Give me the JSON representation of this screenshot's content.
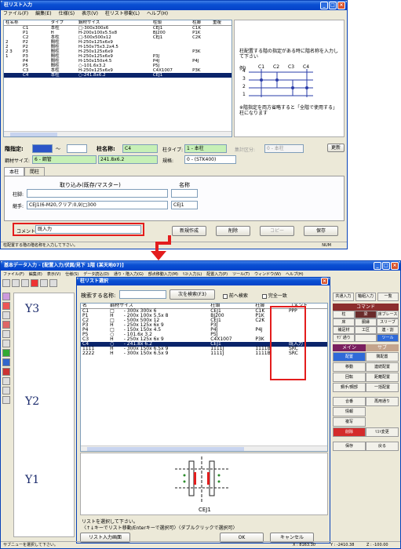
{
  "top": {
    "title": "柱リスト入力",
    "menu": [
      "ファイル(F)",
      "編集(E)",
      "仕様(S)",
      "表示(V)",
      "柱リスト移動(L)",
      "ヘルプ(H)"
    ],
    "cols": [
      "柱名称",
      "タイプ",
      "鋼材サイズ",
      "柱頭",
      "柱脚",
      "重複"
    ],
    "rows": [
      [
        "",
        "C1",
        "本柱",
        "□-300x300x6",
        "CEJ1",
        "C1K",
        ""
      ],
      [
        "",
        "P1",
        "H",
        "H-200x100x5.5x8",
        "BJ200",
        "P1K",
        ""
      ],
      [
        "",
        "C2",
        "本柱",
        "□-500x500x12",
        "CEJ1",
        "C2K",
        ""
      ],
      [
        "2",
        "P2",
        "間柱",
        "H-250x125x6x9",
        "",
        "",
        ""
      ],
      [
        "2",
        "P2",
        "間柱",
        "H-150x75x3.2x4.5",
        "",
        "",
        ""
      ],
      [
        "2  3",
        "P3",
        "間柱",
        "H-250x125x6x9",
        "",
        "P3K",
        ""
      ],
      [
        "1",
        "P3",
        "間柱",
        "H-250x125x6x9",
        "P3J",
        "",
        ""
      ],
      [
        "",
        "P4",
        "間柱",
        "H-150x150x4.5",
        "P4J",
        "P4J",
        ""
      ],
      [
        "",
        "P5",
        "間柱",
        "○-101.6x3.2",
        "P5J",
        "",
        ""
      ],
      [
        "",
        "C3",
        "本柱",
        "H-250x125x6x9",
        "C4X1007",
        "P3K",
        ""
      ],
      [
        "",
        "C4",
        "本柱",
        "○-241.8x6.2",
        "CEJ1",
        "",
        ""
      ]
    ],
    "note1": "柱配置する階の指定がある時に階名称を入力して下さい",
    "example": "例)",
    "floors": [
      "4",
      "3",
      "2",
      "1"
    ],
    "cols_ex": [
      "C1",
      "C2",
      "C3",
      "C4"
    ],
    "note2": "※階指定を両方省略すると「全階で使用する」柱になります",
    "floor_label": "階指定:",
    "tilde": "～",
    "name_label": "柱名称:",
    "name_value": "C4",
    "type_label": "柱タイプ:",
    "type_value": "1 - 本柱",
    "calc_label": "集計区分:",
    "calc_value": "0 - 本柱",
    "update": "更新",
    "steel_label": "鋼材サイズ:",
    "steel_value": "6 - 鋼管",
    "steel_size": "241.8x6.2",
    "spec_label": "規格:",
    "spec_value": "0 - (STK400)",
    "tabs": [
      "本柱",
      "間柱"
    ],
    "import": "取り込み(既存/マスター)",
    "name_hdr": "名称",
    "base_label": "柱脚:",
    "joint_label": "継手:",
    "joint_value": "CEJ1(6-M20,クリア:0,9)□300",
    "joint_name": "CEJ1",
    "comment_label": "コメント",
    "comment_value": "既入力",
    "buttons": [
      "新規作成",
      "削除",
      "コピー",
      "保存"
    ],
    "status": "柱配置する階の階名称を入力して下さい。",
    "num": "NUM"
  },
  "bottom": {
    "title": "基本データ入力 - [配置入力/伏図/見下 1階 (某天地07)]",
    "menu": [
      "ファイル(F)",
      "編集(E)",
      "表示(V)",
      "仕様(S)",
      "データ読込(D)",
      "通り・階入力(G)",
      "部点移動入力(M)",
      "ﾘｽﾄ入力(L)",
      "配置入力(P)",
      "ツール(T)",
      "ウィンドウ(W)",
      "ヘルプ(H)"
    ],
    "dlg_title": "柱リスト選択",
    "search_label": "検索する名称:",
    "next_btn": "次を検索(F3)",
    "prev_chk": "前へ検索",
    "exact_chk": "完全一致",
    "cols": [
      "名",
      "鋼材サイズ",
      "柱頭",
      "柱脚",
      "コメント"
    ],
    "rows": [
      [
        "C1",
        "□",
        "- 300x 300x 6",
        "CEJ1",
        "C1K",
        "PPP"
      ],
      [
        "P1",
        "H",
        "- 200x 100x 5.5x 8",
        "BJ200",
        "P1K",
        ""
      ],
      [
        "C2",
        "□",
        "- 500x 500x 12",
        "CEJ1",
        "C2K",
        ""
      ],
      [
        "P3",
        "H",
        "- 250x 125x 6x 9",
        "P3J",
        "",
        ""
      ],
      [
        "P4",
        "□",
        "- 150x 150x 4.5",
        "P4J",
        "P4J",
        ""
      ],
      [
        "P5",
        "○",
        "- 101.6x 3.2",
        "P5J",
        "",
        ""
      ],
      [
        "C3",
        "H",
        "- 250x 125x 6x 9",
        "C4X1007",
        "P3K",
        ""
      ],
      [
        "C4",
        "○",
        "- 241.8x 6.2",
        "CEJ1",
        "",
        "既入力"
      ],
      [
        "1111",
        "H",
        "- 300x 150x 6.5x 9",
        "1111J",
        "1111B",
        "SRC"
      ],
      [
        "2222",
        "H",
        "- 300x 150x 6.5x 9",
        "1111J",
        "1111B",
        "SRC"
      ]
    ],
    "drawing_label": "CEJ1",
    "msg1": "リストを選択して下さい。",
    "msg2": "〈↑↓キーでリスト移動/Enterキーで選択可〉〈ダブルクリックで選択可〉",
    "list_btn": "リスト入力画面",
    "ok": "OK",
    "cancel": "キャンセル",
    "y_labels": [
      "Y3",
      "Y2",
      "Y1"
    ],
    "rp_top": [
      "共通入力",
      "軸組入力",
      "一覧"
    ],
    "rp_hdr1": "コマンド",
    "rp_cmd": [
      [
        "柱",
        "梁",
        "床ブレース"
      ],
      [
        "床",
        "胴縁",
        "スリーブ"
      ],
      [
        "補足材",
        "工区",
        "連・割"
      ],
      [
        "ｻﾌﾞ通り",
        "",
        "ツール"
      ]
    ],
    "rp_hdr2": "メイン",
    "rp_hdr3": "サブ",
    "rp_main": [
      "配置",
      "移動",
      "回転",
      "鋼手/鋼部"
    ],
    "rp_sub": [
      "隅配置",
      "連続配置",
      "距離配置",
      "一括配置"
    ],
    "rp_extra": [
      [
        "合番",
        "再用通り"
      ],
      [
        "情報",
        ""
      ],
      [
        "複写",
        ""
      ],
      [
        "削除",
        "ﾘｽﾄ変更"
      ],
      [
        "保存",
        "戻る"
      ]
    ],
    "status": "サブニューを選択して下さい。",
    "coords": [
      "X : 8163.30",
      "Y : -2410.38",
      "Z : -100.00"
    ]
  }
}
